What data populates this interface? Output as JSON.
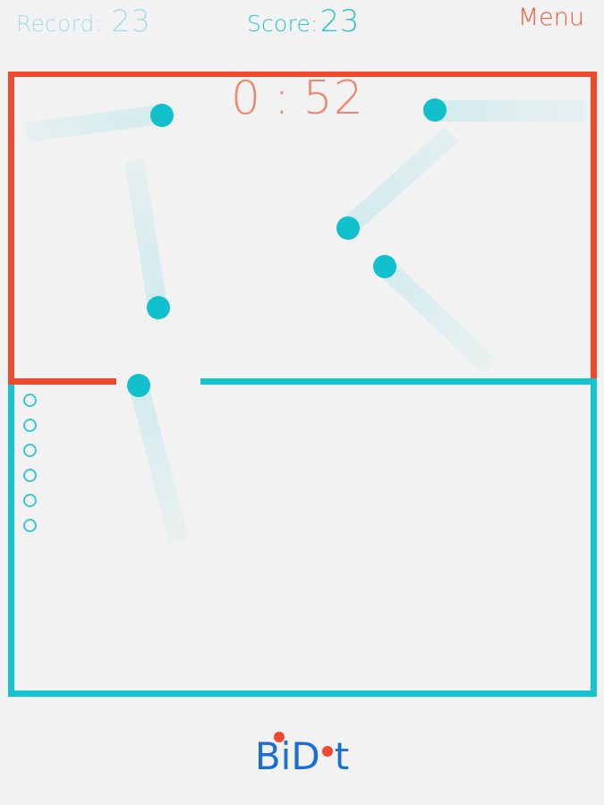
{
  "hud": {
    "record_label": "Record:",
    "record_value": "23",
    "score_label": "Score:",
    "score_value": "23",
    "menu_label": "Menu"
  },
  "timer": {
    "minutes": "0",
    "separator": ":",
    "seconds": "52"
  },
  "lives": {
    "count": 6,
    "icon": "empty-circle"
  },
  "colors": {
    "background": "#f1f2f1",
    "red_zone": "#ef4a2e",
    "teal_zone": "#17c3cc",
    "dot": "#10c0cb",
    "trail": "#d7ecee",
    "timer": "#f08672",
    "record": "#a6dde3",
    "logo": "#1b6fd2"
  },
  "logo": {
    "part1": "B",
    "part2": "i",
    "part3": "D",
    "part4": "t"
  }
}
